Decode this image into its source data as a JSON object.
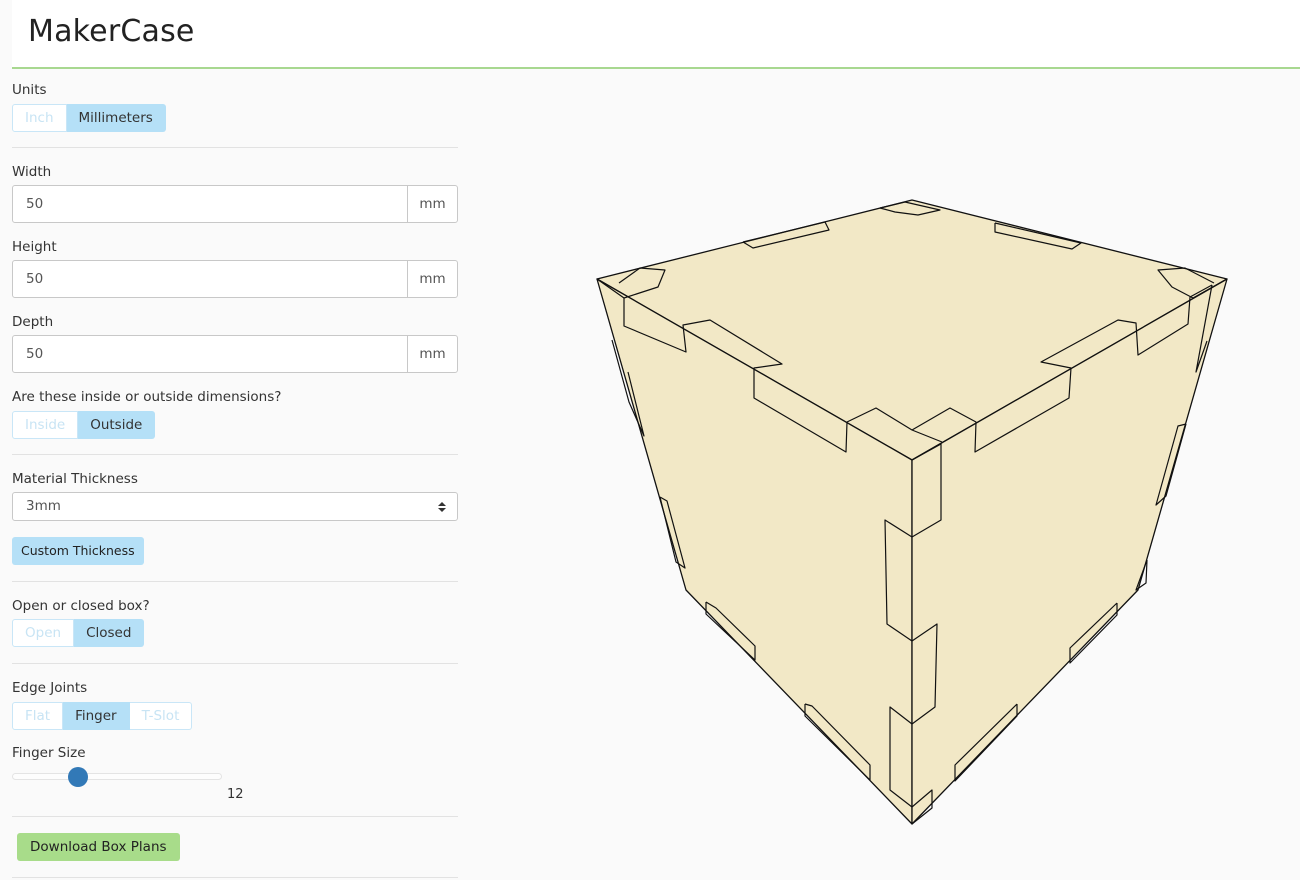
{
  "app": {
    "title": "MakerCase"
  },
  "units": {
    "label": "Units",
    "options": [
      "Inch",
      "Millimeters"
    ],
    "selected": "Millimeters"
  },
  "width": {
    "label": "Width",
    "value": "50",
    "unit": "mm"
  },
  "height": {
    "label": "Height",
    "value": "50",
    "unit": "mm"
  },
  "depth": {
    "label": "Depth",
    "value": "50",
    "unit": "mm"
  },
  "dimension_type": {
    "label": "Are these inside or outside dimensions?",
    "options": [
      "Inside",
      "Outside"
    ],
    "selected": "Outside"
  },
  "material": {
    "label": "Material Thickness",
    "value": "3mm",
    "custom_button": "Custom Thickness"
  },
  "open_closed": {
    "label": "Open or closed box?",
    "options": [
      "Open",
      "Closed"
    ],
    "selected": "Closed"
  },
  "edge_joints": {
    "label": "Edge Joints",
    "options": [
      "Flat",
      "Finger",
      "T-Slot"
    ],
    "selected": "Finger"
  },
  "finger_size": {
    "label": "Finger Size",
    "value": "12"
  },
  "download": {
    "label": "Download Box Plans"
  },
  "colors": {
    "accent_green": "#a8dc8a",
    "button_blue": "#b5e0f7",
    "slider_thumb": "#3279b7",
    "box_face": "#f2e8c6",
    "header_rule": "#a8d890"
  }
}
